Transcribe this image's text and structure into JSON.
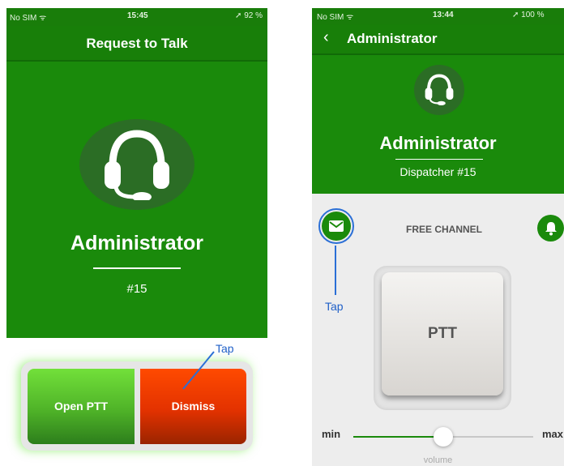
{
  "left": {
    "status": {
      "carrier": "No SIM ᯤ",
      "time": "15:45",
      "right": "➚ 92 %"
    },
    "header_title": "Request to Talk",
    "name": "Administrator",
    "id_label": "#15",
    "buttons": {
      "open_ptt": "Open PTT",
      "dismiss": "Dismiss"
    },
    "annotation": "Tap"
  },
  "right": {
    "status": {
      "carrier": "No SIM ᯤ",
      "time": "13:44",
      "right": "➚ 100 %"
    },
    "back_label": "‹",
    "title": "Administrator",
    "name": "Administrator",
    "role": "Dispatcher #15",
    "channel": "FREE CHANNEL",
    "annotation": "Tap",
    "ptt_label": "PTT",
    "volume": {
      "min": "min",
      "max": "max",
      "label": "volume",
      "level": 0.5
    }
  },
  "colors": {
    "primary": "#1a8a0b",
    "open": "#4fb328",
    "dismiss": "#e33200",
    "annotation": "#2b6fd6"
  },
  "icons": [
    "headset-icon",
    "envelope-icon",
    "bell-icon",
    "wifi-icon",
    "location-arrow-icon",
    "battery-icon"
  ]
}
